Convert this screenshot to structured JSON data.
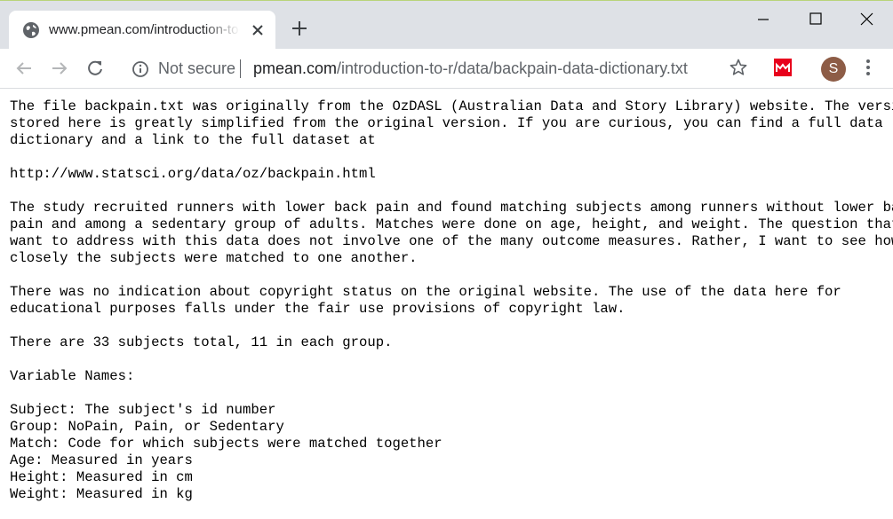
{
  "tab": {
    "title": "www.pmean.com/introduction-to-r/data/backpain-data-dictionary.txt",
    "icon": "globe-icon"
  },
  "toolbar": {
    "security_label": "Not secure",
    "url_host": "pmean.com",
    "url_path": "/introduction-to-r/data/backpain-data-dictionary.txt",
    "avatar_letter": "S"
  },
  "colors": {
    "tabstrip": "#dee1e6",
    "avatar": "#8d5c46",
    "extension": "#e8001c"
  },
  "document": {
    "lines": [
      "The file backpain.txt was originally from the OzDASL (Australian Data and Story Library) website. The version",
      "stored here is greatly simplified from the original version. If you are curious, you can find a full data",
      "dictionary and a link to the full dataset at",
      "",
      "http://www.statsci.org/data/oz/backpain.html",
      "",
      "The study recruited runners with lower back pain and found matching subjects among runners without lower back",
      "pain and among a sedentary group of adults. Matches were done on age, height, and weight. The question that I",
      "want to address with this data does not involve one of the many outcome measures. Rather, I want to see how",
      "closely the subjects were matched to one another.",
      "",
      "There was no indication about copyright status on the original website. The use of the data here for",
      "educational purposes falls under the fair use provisions of copyright law.",
      "",
      "There are 33 subjects total, 11 in each group.",
      "",
      "Variable Names:",
      "",
      "Subject: The subject's id number",
      "Group: NoPain, Pain, or Sedentary",
      "Match: Code for which subjects were matched together",
      "Age: Measured in years",
      "Height: Measured in cm",
      "Weight: Measured in kg"
    ]
  }
}
